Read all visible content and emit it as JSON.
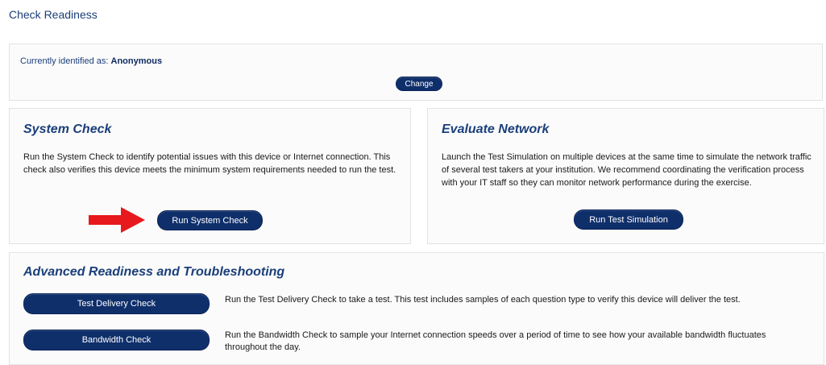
{
  "page": {
    "title": "Check Readiness"
  },
  "identity": {
    "label": "Currently identified as:",
    "name": "Anonymous",
    "change_label": "Change"
  },
  "system_check": {
    "title": "System Check",
    "description": "Run the System Check to identify potential issues with this device or Internet connection. This check also verifies this device meets the minimum system requirements needed to run the test.",
    "button_label": "Run System Check"
  },
  "evaluate_network": {
    "title": "Evaluate Network",
    "description": "Launch the Test Simulation on multiple devices at the same time to simulate the network traffic of several test takers at your institution. We recommend coordinating the verification process with your IT staff so they can monitor network performance during the exercise.",
    "button_label": "Run Test Simulation"
  },
  "advanced": {
    "title": "Advanced Readiness and Troubleshooting",
    "items": [
      {
        "button_label": "Test Delivery Check",
        "description": "Run the Test Delivery Check to take a test. This test includes samples of each question type to verify this device will deliver the test."
      },
      {
        "button_label": "Bandwidth Check",
        "description": "Run the Bandwidth Check to sample your Internet connection speeds over a period of time to see how your available bandwidth fluctuates throughout the day."
      }
    ]
  },
  "colors": {
    "brand_blue": "#0f2f6b",
    "heading_blue": "#1b3f7a",
    "arrow_red": "#e8191c"
  },
  "icons": {
    "arrow": "right-arrow-icon"
  }
}
